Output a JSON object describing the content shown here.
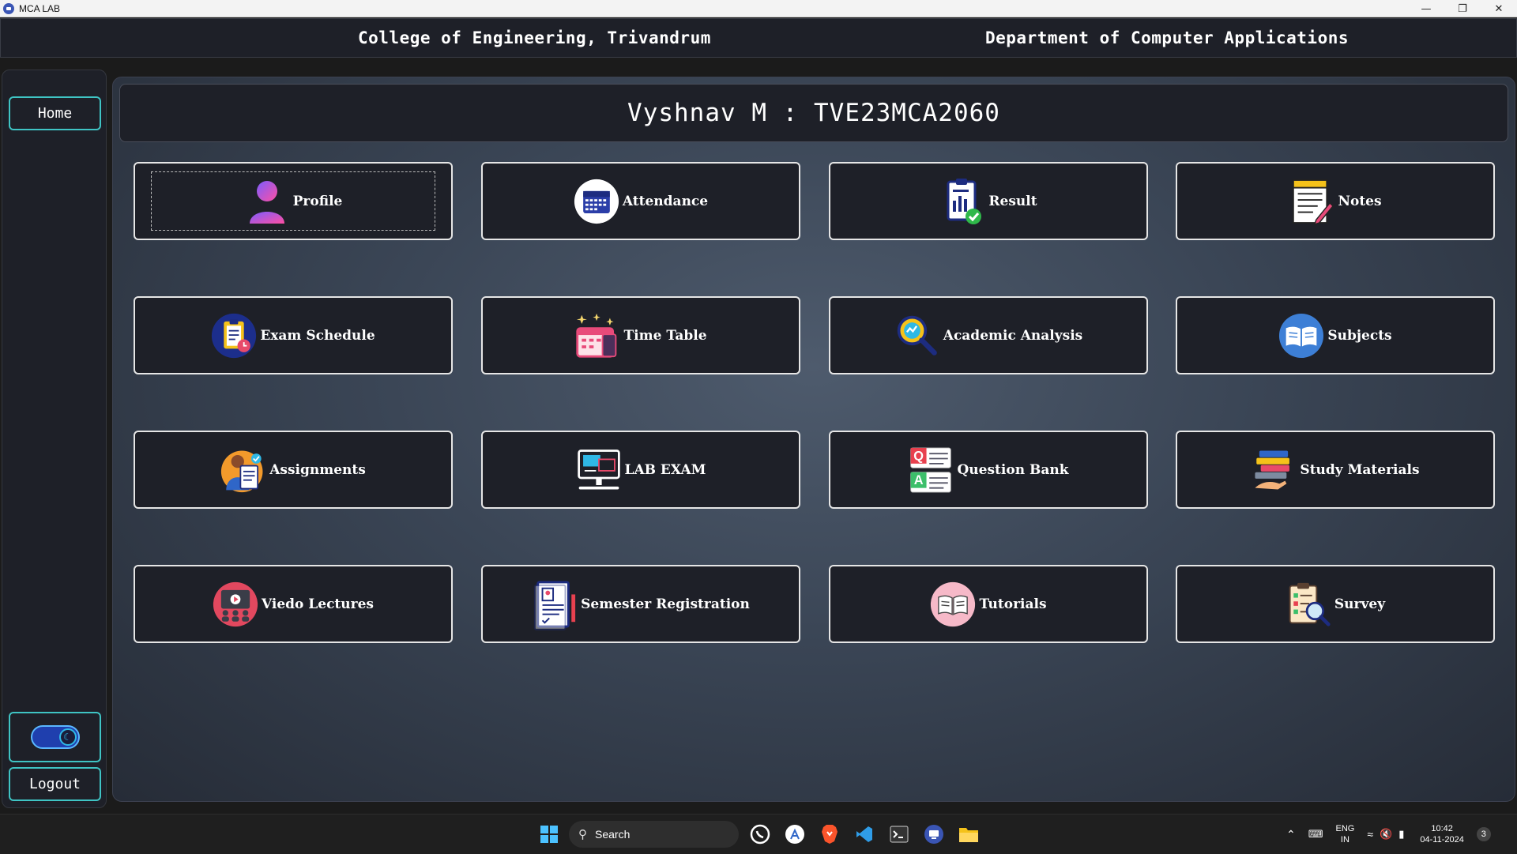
{
  "window": {
    "title": "MCA LAB",
    "minimize_icon": "minimize-icon",
    "restore_icon": "restore-icon",
    "close_icon": "close-icon"
  },
  "header": {
    "college": "College of Engineering, Trivandrum",
    "department": "Department of Computer Applications"
  },
  "sidebar": {
    "home_label": "Home",
    "logout_label": "Logout",
    "theme_toggle_icon": "moon-icon"
  },
  "user": {
    "banner": "Vyshnav M : TVE23MCA2060"
  },
  "tiles": [
    {
      "label": "Profile",
      "icon": "profile-icon"
    },
    {
      "label": "Attendance",
      "icon": "calendar-icon"
    },
    {
      "label": "Result",
      "icon": "result-clipboard-icon"
    },
    {
      "label": "Notes",
      "icon": "notes-icon"
    },
    {
      "label": "Exam Schedule",
      "icon": "exam-schedule-icon"
    },
    {
      "label": "Time Table",
      "icon": "timetable-icon"
    },
    {
      "label": "Academic Analysis",
      "icon": "analysis-magnifier-icon"
    },
    {
      "label": "Subjects",
      "icon": "book-icon"
    },
    {
      "label": "Assignments",
      "icon": "assignment-icon"
    },
    {
      "label": "LAB EXAM",
      "icon": "computer-icon"
    },
    {
      "label": "Question Bank",
      "icon": "qa-icon"
    },
    {
      "label": "Study Materials",
      "icon": "books-stack-icon"
    },
    {
      "label": "Viedo Lectures",
      "icon": "video-lecture-icon"
    },
    {
      "label": "Semester Registration",
      "icon": "registration-form-icon"
    },
    {
      "label": "Tutorials",
      "icon": "open-book-icon"
    },
    {
      "label": "Survey",
      "icon": "survey-icon"
    }
  ],
  "taskbar": {
    "search_placeholder": "Search",
    "language": "ENG",
    "region": "IN",
    "time": "10:42",
    "date": "04-11-2024",
    "notification_count": "3",
    "pinned": [
      "windows-start-icon",
      "whatsapp-icon",
      "app-store-icon",
      "brave-icon",
      "vscode-icon",
      "terminal-icon",
      "mca-lab-icon",
      "file-explorer-icon"
    ]
  },
  "colors": {
    "accent": "#3fc4c4",
    "panel": "#1e2028",
    "tile_border": "#e6e6e6"
  }
}
